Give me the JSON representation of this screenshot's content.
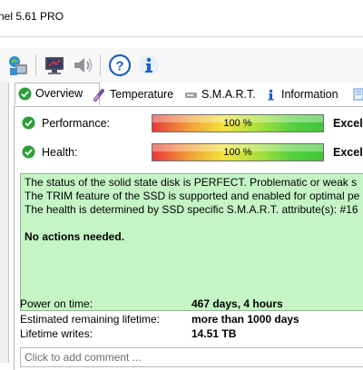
{
  "window": {
    "title": "nel 5.61 PRO"
  },
  "toolbar": {
    "icons": [
      "network-disk-icon",
      "monitor-icon",
      "speaker-icon",
      "help-icon",
      "info-icon"
    ]
  },
  "tabs": [
    {
      "label": "Overview",
      "icon": "check-icon",
      "active": true
    },
    {
      "label": "Temperature",
      "icon": "thermometer-icon",
      "active": false
    },
    {
      "label": "S.M.A.R.T.",
      "icon": "drive-icon",
      "active": false
    },
    {
      "label": "Information",
      "icon": "info-icon",
      "active": false
    }
  ],
  "overview": {
    "performance": {
      "label": "Performance:",
      "percent_text": "100 %",
      "value": 100,
      "rating": "Excell"
    },
    "health": {
      "label": "Health:",
      "percent_text": "100 %",
      "value": 100,
      "rating": "Excell"
    },
    "status_lines": [
      "The status of the solid state disk is PERFECT. Problematic or weak s",
      "The TRIM feature of the SSD is supported and enabled for optimal pe",
      "The health is determined by SSD specific S.M.A.R.T. attribute(s):  #16"
    ],
    "action_text": "No actions needed.",
    "power_on": {
      "label": "Power on time:",
      "value": "467 days, 4 hours"
    },
    "lifetime": {
      "label": "Estimated remaining lifetime:",
      "value": "more than 1000 days"
    },
    "writes": {
      "label": "Lifetime writes:",
      "value": "14.51 TB"
    },
    "comment_placeholder": "Click to add comment ..."
  },
  "colors": {
    "status_background": "#c5f5c5",
    "check_green": "#2e9e3a"
  }
}
